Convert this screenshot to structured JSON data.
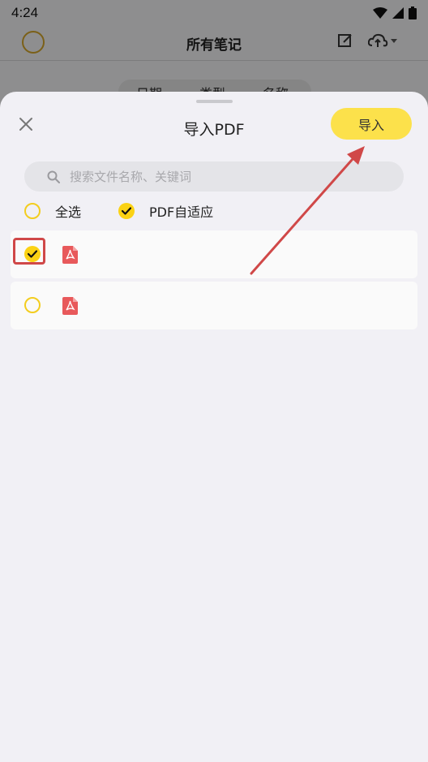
{
  "status_bar": {
    "time": "4:24"
  },
  "background_app": {
    "title": "所有笔记",
    "tabs": [
      "日期",
      "类型",
      "名称"
    ]
  },
  "sheet": {
    "title": "导入PDF",
    "import_label": "导入",
    "search_placeholder": "搜索文件名称、关键词",
    "select_all_label": "全选",
    "pdf_adapt_label": "PDF自适应",
    "pdf_adapt_checked": true,
    "files": [
      {
        "name": "",
        "checked": true
      },
      {
        "name": "",
        "checked": false
      }
    ]
  },
  "colors": {
    "accent_yellow": "#fce14b",
    "check_yellow": "#fbd214",
    "pdf_red": "#e8595b",
    "annotation_red": "#d04848"
  }
}
